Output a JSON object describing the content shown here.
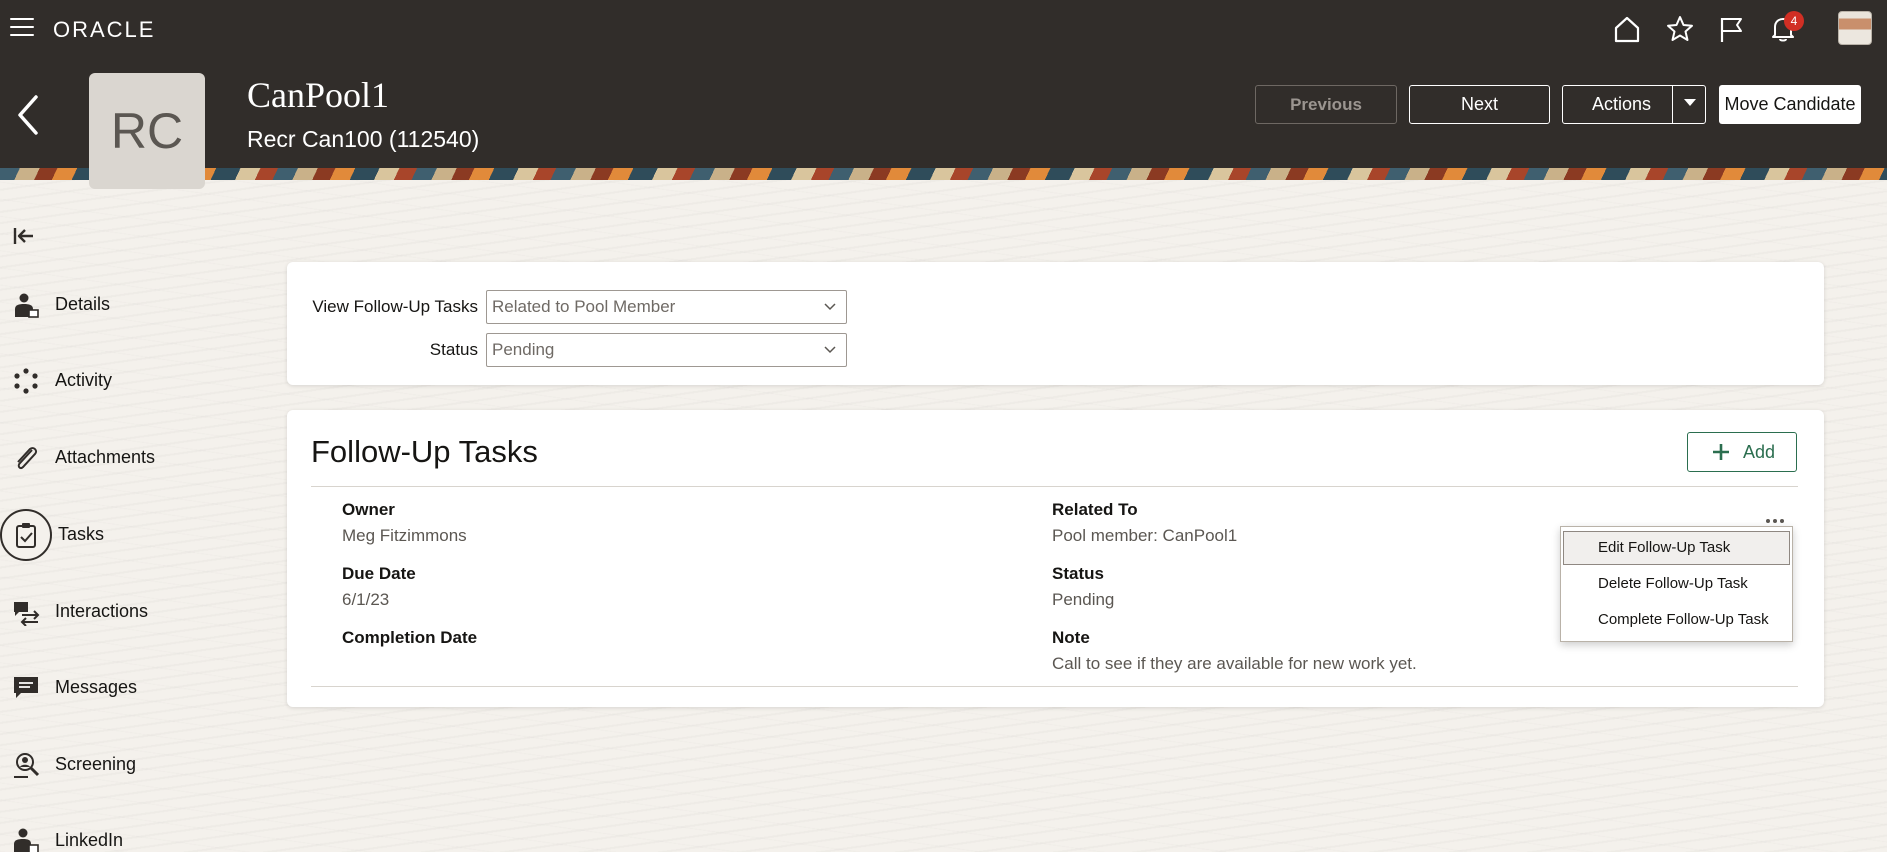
{
  "app": {
    "brand": "ORACLE",
    "notification_count": "4"
  },
  "candidate": {
    "initials": "RC",
    "name": "CanPool1",
    "subtitle": "Recr Can100 (112540)"
  },
  "header_buttons": {
    "previous": "Previous",
    "next": "Next",
    "actions": "Actions",
    "move_candidate": "Move Candidate"
  },
  "nav": {
    "items": [
      {
        "label": "Details",
        "icon": "person-card-icon"
      },
      {
        "label": "Activity",
        "icon": "activity-icon"
      },
      {
        "label": "Attachments",
        "icon": "paperclip-icon"
      },
      {
        "label": "Tasks",
        "icon": "clipboard-check-icon",
        "selected": true
      },
      {
        "label": "Interactions",
        "icon": "interactions-icon"
      },
      {
        "label": "Messages",
        "icon": "message-icon"
      },
      {
        "label": "Screening",
        "icon": "screening-icon"
      },
      {
        "label": "LinkedIn",
        "icon": "linkedin-person-icon"
      }
    ]
  },
  "filters": {
    "view_label": "View Follow-Up Tasks",
    "view_value": "Related to Pool Member",
    "status_label": "Status",
    "status_value": "Pending"
  },
  "tasks": {
    "title": "Follow-Up Tasks",
    "add_label": "Add",
    "item": {
      "owner_label": "Owner",
      "owner_value": "Meg Fitzimmons",
      "due_label": "Due Date",
      "due_value": "6/1/23",
      "completion_label": "Completion Date",
      "related_label": "Related To",
      "related_value": "Pool member: CanPool1",
      "status_label": "Status",
      "status_value": "Pending",
      "note_label": "Note",
      "note_value": "Call to see if they are available for new work yet."
    },
    "menu": [
      "Edit Follow-Up Task",
      "Delete Follow-Up Task",
      "Complete Follow-Up Task"
    ]
  },
  "colors": {
    "header_bg": "#312d2a",
    "accent_green": "#2b6e4f",
    "badge_red": "#d12f24"
  }
}
